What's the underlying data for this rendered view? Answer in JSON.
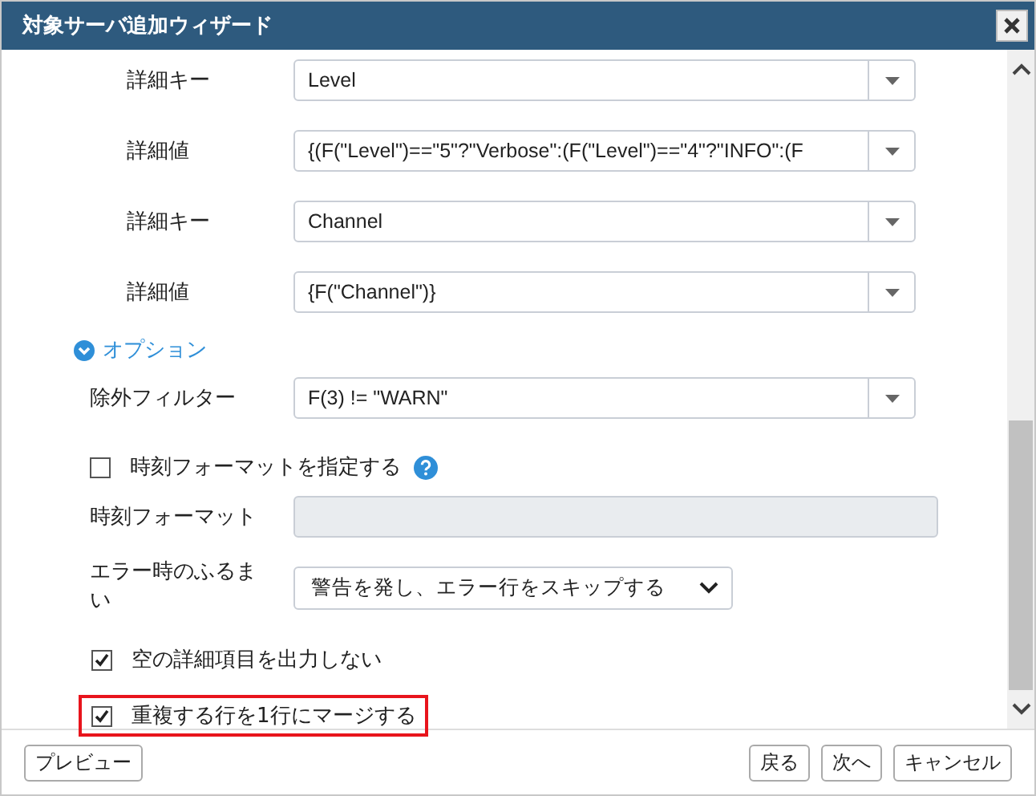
{
  "window": {
    "title": "対象サーバ追加ウィザード"
  },
  "detail_rows": [
    {
      "label": "詳細キー",
      "value": "Level"
    },
    {
      "label": "詳細値",
      "value": "{(F(\"Level\")==\"5\"?\"Verbose\":(F(\"Level\")==\"4\"?\"INFO\":(F"
    },
    {
      "label": "詳細キー",
      "value": "Channel"
    },
    {
      "label": "詳細値",
      "value": "{F(\"Channel\")}"
    }
  ],
  "options": {
    "label": "オプション",
    "expanded": true,
    "exclude_filter": {
      "label": "除外フィルター",
      "value": "F(3) != \"WARN\""
    },
    "time_format_toggle": {
      "label": "時刻フォーマットを指定する",
      "checked": false
    },
    "time_format": {
      "label": "時刻フォーマット",
      "disabled": true
    },
    "error_behavior": {
      "label": "エラー時のふるまい",
      "value": "警告を発し、エラー行をスキップする"
    },
    "checkboxes": [
      {
        "label": "空の詳細項目を出力しない",
        "checked": true,
        "highlighted": false
      },
      {
        "label": "重複する行を1行にマージする",
        "checked": true,
        "highlighted": true
      }
    ]
  },
  "buttons_left": [
    "プレビュー"
  ],
  "buttons_right": [
    "戻る",
    "次へ",
    "キャンセル"
  ]
}
